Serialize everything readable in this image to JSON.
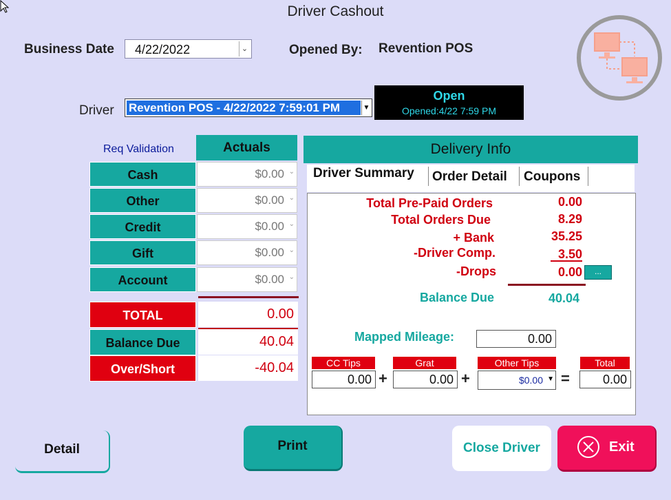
{
  "window": {
    "title": "Driver Cashout"
  },
  "header": {
    "business_date_label": "Business Date",
    "business_date_value": "4/22/2022",
    "opened_by_label": "Opened By:",
    "opened_by_value": "Revention POS",
    "driver_label": "Driver",
    "driver_value": "Revention POS - 4/22/2022 7:59:01 PM",
    "status_title": "Open",
    "status_opened": "Opened:4/22 7:59 PM"
  },
  "payments": {
    "req_validation_label": "Req Validation",
    "actuals_label": "Actuals",
    "rows": [
      {
        "label": "Cash",
        "value": "$0.00"
      },
      {
        "label": "Other",
        "value": "$0.00"
      },
      {
        "label": "Credit",
        "value": "$0.00"
      },
      {
        "label": "Gift",
        "value": "$0.00"
      },
      {
        "label": "Account",
        "value": "$0.00"
      }
    ],
    "total_label": "TOTAL",
    "total_value": "0.00",
    "balance_due_label": "Balance Due",
    "balance_due_value": "40.04",
    "over_short_label": "Over/Short",
    "over_short_value": "-40.04"
  },
  "delivery": {
    "title": "Delivery Info",
    "tabs": [
      "Driver Summary",
      "Order Detail",
      "Coupons"
    ],
    "summary": [
      {
        "label": "Total Pre-Paid Orders",
        "value": "0.00"
      },
      {
        "label": "Total Orders Due",
        "value": "8.29"
      },
      {
        "label": "+ Bank",
        "value": "35.25"
      },
      {
        "label": "-Driver Comp.",
        "value": "3.50"
      },
      {
        "label": "-Drops",
        "value": "0.00"
      }
    ],
    "drops_button": "...",
    "balance_due_label": "Balance Due",
    "balance_due_value": "40.04",
    "mileage_label": "Mapped Mileage:",
    "mileage_value": "0.00",
    "tips": {
      "cc_label": "CC Tips",
      "cc_value": "0.00",
      "grat_label": "Grat",
      "grat_value": "0.00",
      "other_label": "Other Tips",
      "other_value": "$0.00",
      "total_label": "Total",
      "total_value": "0.00"
    }
  },
  "buttons": {
    "detail": "Detail",
    "print": "Print",
    "close_driver": "Close Driver",
    "exit": "Exit"
  }
}
